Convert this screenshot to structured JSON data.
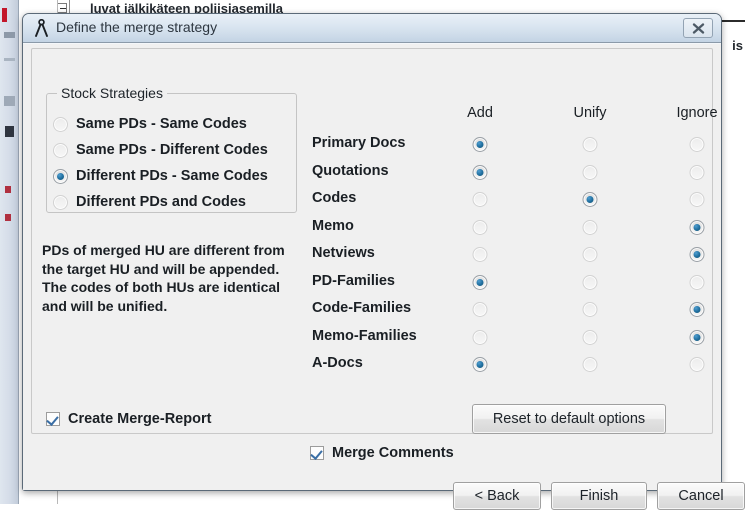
{
  "background": {
    "document_title": "luvat jälkikäteen poliisiasemilla",
    "right_edge_text": "is",
    "toolbar_icons": [
      "toolbar-icon-1",
      "toolbar-icon-2",
      "toolbar-icon-3",
      "toolbar-icon-4",
      "toolbar-icon-5",
      "toolbar-icon-6"
    ]
  },
  "dialog": {
    "title": "Define the merge strategy",
    "title_icon": "merge-compass-icon",
    "close_icon": "close-icon",
    "stock_strategies": {
      "legend": "Stock Strategies",
      "selected_index": 2,
      "options": [
        {
          "label": "Same PDs - Same Codes",
          "selected": false
        },
        {
          "label": "Same PDs - Different Codes",
          "selected": false
        },
        {
          "label": "Different PDs - Same Codes",
          "selected": true
        },
        {
          "label": "Different PDs and Codes",
          "selected": false
        }
      ]
    },
    "description": "PDs of merged HU are different from the target HU and will be appended. The codes of both HUs are identical and will be unified.",
    "matrix": {
      "columns": [
        "Add",
        "Unify",
        "Ignore"
      ],
      "rows": [
        {
          "label": "Primary Docs",
          "selected": "Add"
        },
        {
          "label": "Quotations",
          "selected": "Add"
        },
        {
          "label": "Codes",
          "selected": "Unify"
        },
        {
          "label": "Memo",
          "selected": "Ignore"
        },
        {
          "label": "Netviews",
          "selected": "Ignore"
        },
        {
          "label": "PD-Families",
          "selected": "Add"
        },
        {
          "label": "Code-Families",
          "selected": "Ignore"
        },
        {
          "label": "Memo-Families",
          "selected": "Ignore"
        },
        {
          "label": "A-Docs",
          "selected": "Add"
        }
      ]
    },
    "checkboxes": {
      "create_merge_report": {
        "label": "Create Merge-Report",
        "checked": true
      },
      "merge_comments": {
        "label": "Merge Comments",
        "checked": true
      }
    },
    "buttons": {
      "reset_defaults": "Reset to default options",
      "back": "< Back",
      "finish": "Finish",
      "cancel": "Cancel"
    }
  },
  "colors": {
    "accent_radio": "#1f6e9e",
    "accent_check": "#3a6ea5",
    "titlebar": "#cedcea",
    "dialog_bg": "#f0f0f0"
  }
}
